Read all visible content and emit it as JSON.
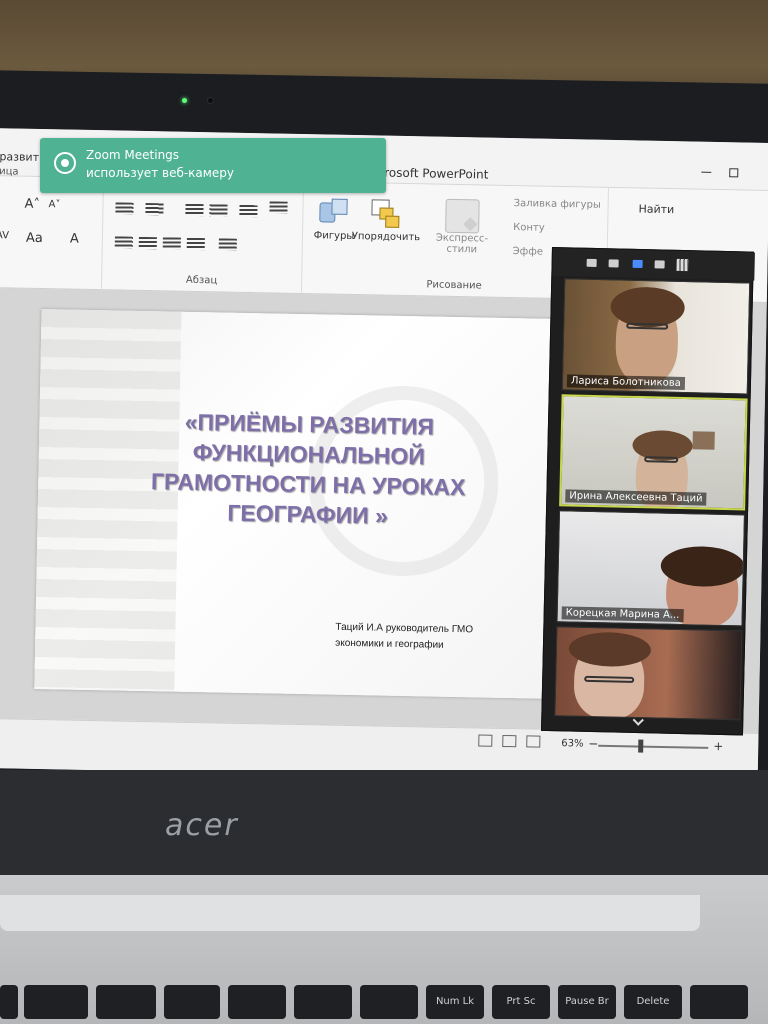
{
  "zoom_toast": {
    "app": "Zoom Meetings",
    "message": "использует веб-камеру"
  },
  "powerpoint": {
    "title_fragment_left": "развити",
    "app_title": "rosoft PowerPoint",
    "menu_left": "ица",
    "ribbon": {
      "group_paragraph": "Абзац",
      "group_drawing": "Рисование",
      "shapes_label": "Фигуры",
      "arrange_label": "Упорядочить",
      "styles_label": "Экспресс-стили",
      "fill_label": "Заливка фигуры",
      "outline_label": "Конту",
      "effects_label": "Эффе",
      "find_label": "Найти"
    },
    "status": {
      "zoom_level": "63%"
    }
  },
  "slide": {
    "title_line1": "«ПРИЁМЫ РАЗВИТИЯ",
    "title_line2": "ФУНКЦИОНАЛЬНОЙ",
    "title_line3": "ГРАМОТНОСТИ  НА УРОКАХ",
    "title_line4": "ГЕОГРАФИИ  »",
    "author_line1": "Таций И.А  руководитель ГМО",
    "author_line2": "экономики и географии"
  },
  "participants": [
    {
      "name": "Лариса Болотникова"
    },
    {
      "name": "Ирина Алексеевна Таций"
    },
    {
      "name": "Корецкая Марина А..."
    }
  ],
  "laptop": {
    "brand": "acer",
    "keys": [
      "Prt Sc",
      "Pause Br",
      "Num Lk",
      "Delete"
    ]
  }
}
